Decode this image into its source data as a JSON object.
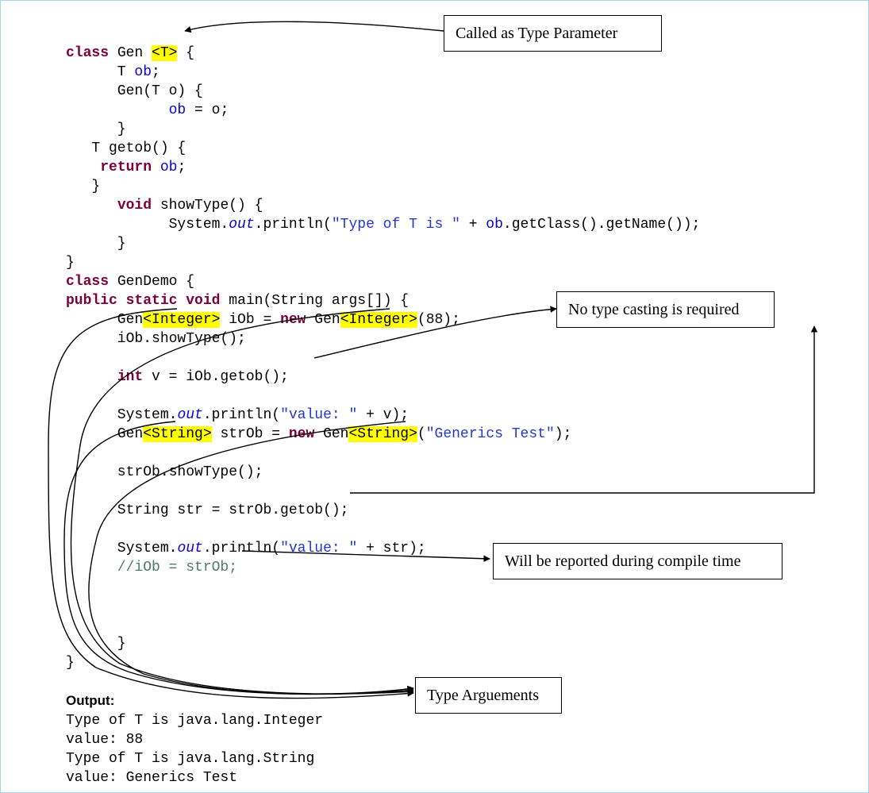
{
  "code": {
    "l1": {
      "kw": "class",
      "sp1": " Gen ",
      "hl": "<T>",
      "rest": " {"
    },
    "l2": {
      "indent": "      T ",
      "member": "ob",
      "rest": ";"
    },
    "l3": {
      "text": "      Gen(T o) {"
    },
    "l4": {
      "indent": "            ",
      "member": "ob",
      "rest": " = o;"
    },
    "l5": {
      "text": "      }"
    },
    "l6": {
      "text": "   T getob() {"
    },
    "l7": {
      "indent": "    ",
      "kw": "return",
      "rest": " ",
      "member": "ob",
      "semi": ";"
    },
    "l8": {
      "text": "   }"
    },
    "l9": {
      "indent": "      ",
      "kw": "void",
      "name": " showType() {"
    },
    "l10": {
      "indent": "            System.",
      "out": "out",
      "mid": ".println(",
      "str": "\"Type of T is \"",
      "rest": " + ",
      "member": "ob",
      "tail": ".getClass().getName());"
    },
    "l11": {
      "text": "      }"
    },
    "l12": {
      "text": "}"
    },
    "l13": {
      "kw": "class",
      "rest": " GenDemo {"
    },
    "l14": {
      "kw1": "public",
      "sp1": " ",
      "kw2": "static",
      "sp2": " ",
      "kw3": "void",
      "rest": " main(String args[]) {"
    },
    "l15": {
      "indent": "      Gen",
      "hl1": "<Integer>",
      "mid": " iOb = ",
      "kw": "new",
      "mid2": " Gen",
      "hl2": "<Integer>",
      "tail": "(88);"
    },
    "l16": {
      "text": "      iOb.showType();"
    },
    "l17": {
      "text": ""
    },
    "l18": {
      "indent": "      ",
      "kw": "int",
      "rest": " v = iOb.getob();"
    },
    "l19": {
      "text": ""
    },
    "l20": {
      "indent": "      System.",
      "out": "out",
      "mid": ".println(",
      "str": "\"value: \"",
      "rest": " + v);"
    },
    "l21": {
      "indent": "      Gen",
      "hl1": "<String>",
      "mid": " strOb = ",
      "kw": "new",
      "mid2": " Gen",
      "hl2": "<String>",
      "tail": "(",
      "str": "\"Generics Test\"",
      "tail2": ");"
    },
    "l22": {
      "text": ""
    },
    "l23": {
      "text": "      strOb.showType();"
    },
    "l24": {
      "text": ""
    },
    "l25": {
      "text": "      String str = strOb.getob();"
    },
    "l26": {
      "text": ""
    },
    "l27": {
      "indent": "      System.",
      "out": "out",
      "mid": ".println(",
      "str": "\"value: \"",
      "rest": " + str);"
    },
    "l28": {
      "indent": "      ",
      "cmt": "//iOb = strOb;"
    },
    "l29": {
      "text": ""
    },
    "l30": {
      "text": ""
    },
    "l31": {
      "text": ""
    },
    "l32": {
      "text": "      }"
    },
    "l33": {
      "text": "}"
    }
  },
  "output": {
    "heading": "Output:",
    "line1": "Type of T is java.lang.Integer",
    "line2": "value: 88",
    "line3": "Type of T is java.lang.String",
    "line4": "value: Generics Test"
  },
  "callouts": {
    "typeParam": "Called as Type Parameter",
    "noCast": "No type casting is required",
    "compileErr": "Will be reported during compile time",
    "typeArgs": "Type Arguements"
  }
}
